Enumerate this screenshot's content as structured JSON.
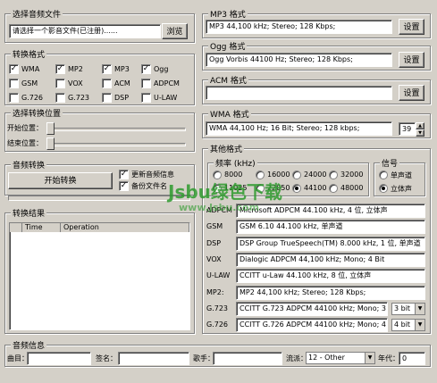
{
  "select_file": {
    "title": "选择音频文件",
    "path_value": "请选择一个影音文件(已注册)......",
    "browse_label": "浏览"
  },
  "convert_format": {
    "title": "转换格式",
    "items": [
      {
        "label": "WMA",
        "checked": true
      },
      {
        "label": "MP2",
        "checked": true
      },
      {
        "label": "MP3",
        "checked": true
      },
      {
        "label": "Ogg",
        "checked": true
      },
      {
        "label": "GSM",
        "checked": false
      },
      {
        "label": "VOX",
        "checked": false
      },
      {
        "label": "ACM",
        "checked": false
      },
      {
        "label": "ADPCM",
        "checked": false
      },
      {
        "label": "G.726",
        "checked": false
      },
      {
        "label": "G.723",
        "checked": false
      },
      {
        "label": "DSP",
        "checked": false
      },
      {
        "label": "U-LAW",
        "checked": false
      }
    ]
  },
  "convert_position": {
    "title": "选择转换位置",
    "start_label": "开始位置：",
    "end_label": "结束位置："
  },
  "audio_convert": {
    "title": "音频转换",
    "start_button": "开始转换",
    "update_info_label": "更新音频信息",
    "backup_label": "备份文件名",
    "update_checked": true,
    "backup_checked": true
  },
  "results": {
    "title": "转换结果",
    "columns": [
      "Time",
      "Operation"
    ]
  },
  "mp3": {
    "title": "MP3 格式",
    "value": "MP3 44,100 kHz; Stereo;  128 Kbps;",
    "settings_label": "设置"
  },
  "ogg": {
    "title": "Ogg 格式",
    "value": "Ogg Vorbis 44100 Hz; Stereo; 128 Kbps;",
    "settings_label": "设置"
  },
  "acm": {
    "title": "ACM 格式",
    "value": "",
    "settings_label": "设置"
  },
  "wma": {
    "title": "WMA 格式",
    "value": "WMA 44,100 Hz; 16 Bit; Stereo; 128 kbps;",
    "spin_value": "39"
  },
  "other_format": {
    "title": "其他格式",
    "freq_title": "频率 (kHz)",
    "freq_labels": [
      "8000",
      "16000",
      "24000",
      "32000",
      "11025",
      "22050",
      "44100",
      "48000"
    ],
    "selected_freq": "44100",
    "channel_title": "信号",
    "mono_label": "单声道",
    "stereo_label": "立体声",
    "rows": [
      {
        "label": "ADPCM",
        "value": "Microsoft ADPCM 44.100 kHz, 4 位, 立体声"
      },
      {
        "label": "GSM",
        "value": "GSM 6.10 44.100 kHz, 单声道"
      },
      {
        "label": "DSP",
        "value": "DSP Group TrueSpeech(TM) 8.000 kHz, 1 位, 单声道"
      },
      {
        "label": "VOX",
        "value": "Dialogic ADPCM 44,100 kHz; Mono; 4 Bit"
      },
      {
        "label": "U-LAW",
        "value": "CCITT u-Law 44.100 kHz, 8 位, 立体声"
      },
      {
        "label": "MP2:",
        "value": "MP2 44,100 kHz; Stereo;  128 Kbps;"
      },
      {
        "label": "G.723",
        "value": "CCITT G.723 ADPCM 44100 kHz; Mono; 3",
        "bits": "3 bit"
      },
      {
        "label": "G.726",
        "value": "CCITT G.726 ADPCM 44100 kHz; Mono; 4",
        "bits": "4 bit"
      }
    ]
  },
  "audio_info": {
    "title": "音频信息",
    "song_label": "曲目：",
    "artist_label": "签名：",
    "singer_label": "歌手：",
    "genre_label": "流派：",
    "genre_value": "12 - Other",
    "year_label": "年代：",
    "year_value": "0"
  },
  "watermark": {
    "text": "Jsbu绿色下载",
    "url": "www.Jsbu.com"
  }
}
